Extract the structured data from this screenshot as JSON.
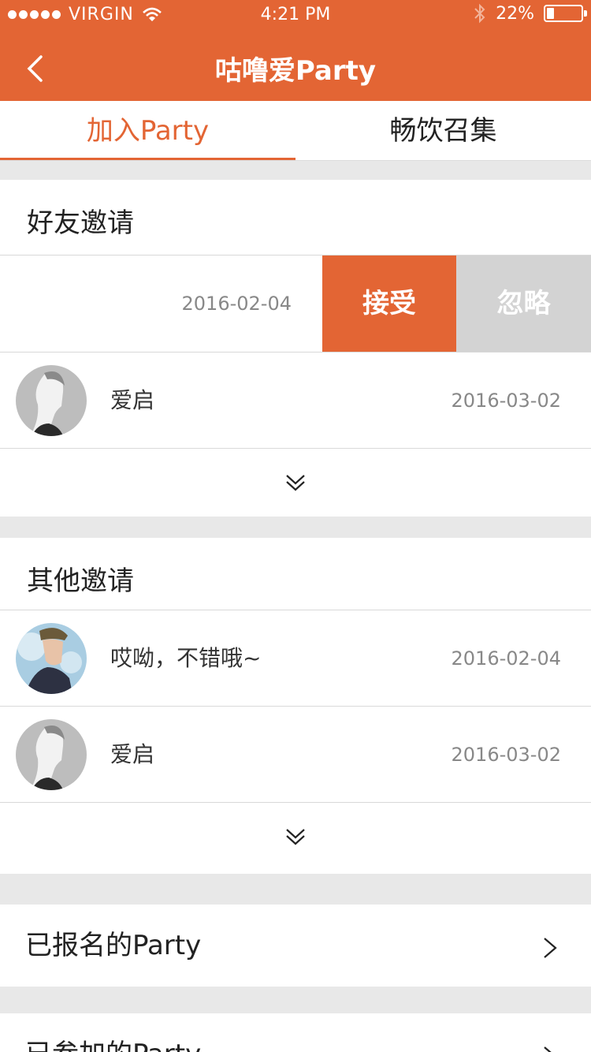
{
  "status_bar": {
    "carrier": "VIRGIN",
    "time": "4:21 PM",
    "battery": "22%",
    "battery_level": 0.22
  },
  "nav": {
    "title": "咕噜爱Party"
  },
  "tabs": [
    {
      "label": "加入Party",
      "active": true
    },
    {
      "label": "畅饮召集",
      "active": false
    }
  ],
  "friend_invites": {
    "title": "好友邀请",
    "swiped_item": {
      "date": "2016-02-04",
      "accept_label": "接受",
      "ignore_label": "忽略"
    },
    "items": [
      {
        "name": "爱启",
        "date": "2016-03-02",
        "avatar": "woman-profile"
      }
    ]
  },
  "other_invites": {
    "title": "其他邀请",
    "items": [
      {
        "name": "哎呦，不错哦~",
        "date": "2016-02-04",
        "avatar": "man-in-cap"
      },
      {
        "name": "爱启",
        "date": "2016-03-02",
        "avatar": "woman-profile"
      }
    ]
  },
  "links": [
    {
      "label": "已报名的Party"
    },
    {
      "label": "已参加的Party"
    }
  ],
  "colors": {
    "accent": "#e36534",
    "ignore": "#d3d3d3",
    "background": "#e8e8e8"
  }
}
